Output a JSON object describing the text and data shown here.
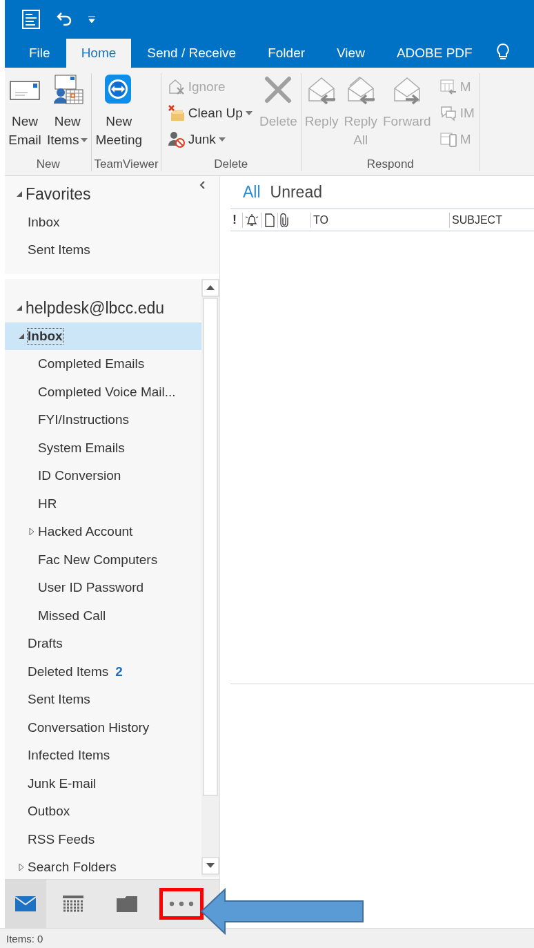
{
  "tabs": [
    {
      "label": "File",
      "selected": false
    },
    {
      "label": "Home",
      "selected": true
    },
    {
      "label": "Send / Receive",
      "selected": false
    },
    {
      "label": "Folder",
      "selected": false
    },
    {
      "label": "View",
      "selected": false
    },
    {
      "label": "ADOBE PDF",
      "selected": false
    }
  ],
  "ribbon": {
    "groups": [
      {
        "label": "New",
        "buttons": [
          {
            "kind": "large",
            "lines": [
              "New",
              "Email"
            ],
            "disabled": false,
            "has_menu": false
          },
          {
            "kind": "large",
            "lines": [
              "New",
              "Items"
            ],
            "disabled": false,
            "has_menu": true
          }
        ]
      },
      {
        "label": "TeamViewer",
        "buttons": [
          {
            "kind": "large",
            "lines": [
              "New",
              "Meeting"
            ],
            "disabled": false,
            "has_menu": false
          }
        ]
      },
      {
        "label": "Delete",
        "buttons": [
          {
            "kind": "stack",
            "items": [
              {
                "label": "Ignore",
                "disabled": true,
                "has_menu": false
              },
              {
                "label": "Clean Up",
                "disabled": false,
                "has_menu": true
              },
              {
                "label": "Junk",
                "disabled": false,
                "has_menu": true
              }
            ]
          },
          {
            "kind": "large",
            "lines": [
              "Delete"
            ],
            "disabled": true,
            "has_menu": false
          }
        ]
      },
      {
        "label": "Respond",
        "buttons": [
          {
            "kind": "large",
            "lines": [
              "Reply"
            ],
            "disabled": true,
            "has_menu": false
          },
          {
            "kind": "large",
            "lines": [
              "Reply",
              "All"
            ],
            "disabled": true,
            "has_menu": false
          },
          {
            "kind": "large",
            "lines": [
              "Forward"
            ],
            "disabled": true,
            "has_menu": false
          },
          {
            "kind": "stack",
            "items": [
              {
                "label": "M",
                "disabled": true,
                "has_menu": false
              },
              {
                "label": "IM",
                "disabled": true,
                "has_menu": false
              },
              {
                "label": "M",
                "disabled": true,
                "has_menu": false
              }
            ]
          }
        ]
      }
    ]
  },
  "folder_pane": {
    "sections": [
      {
        "label": "Favorites",
        "expanded": true,
        "children": [
          {
            "label": "Inbox",
            "selected": false
          },
          {
            "label": "Sent Items",
            "selected": false
          }
        ]
      },
      {
        "label": "helpdesk@lbcc.edu",
        "expanded": true,
        "children": [
          {
            "label": "Inbox",
            "selected": true,
            "expanded": true,
            "children": [
              {
                "label": "Completed Emails",
                "selected": false
              },
              {
                "label": "Completed Voice Mail...",
                "selected": false
              },
              {
                "label": "FYI/Instructions",
                "selected": false
              },
              {
                "label": "System Emails",
                "selected": false
              },
              {
                "label": "ID Conversion",
                "selected": false
              },
              {
                "label": "HR",
                "selected": false
              },
              {
                "label": "Hacked Account",
                "selected": false,
                "expanded": false
              },
              {
                "label": "Fac New Computers",
                "selected": false
              },
              {
                "label": "User ID  Password",
                "selected": false
              },
              {
                "label": "Missed Call",
                "selected": false
              }
            ]
          },
          {
            "label": "Drafts",
            "selected": false
          },
          {
            "label": "Deleted Items",
            "selected": false,
            "count": "2"
          },
          {
            "label": "Sent Items",
            "selected": false
          },
          {
            "label": "Conversation History",
            "selected": false
          },
          {
            "label": "Infected Items",
            "selected": false
          },
          {
            "label": "Junk E-mail",
            "selected": false
          },
          {
            "label": "Outbox",
            "selected": false
          },
          {
            "label": "RSS Feeds",
            "selected": false
          },
          {
            "label": "Search Folders",
            "selected": false,
            "expanded": false
          }
        ]
      }
    ]
  },
  "nav_bar": [
    {
      "kind": "mail",
      "selected": true,
      "highlighted": false
    },
    {
      "kind": "calendar",
      "selected": false,
      "highlighted": false
    },
    {
      "kind": "folders",
      "selected": false,
      "highlighted": false
    },
    {
      "kind": "more",
      "selected": false,
      "highlighted": true
    }
  ],
  "message_list": {
    "filters": [
      {
        "label": "All",
        "selected": true
      },
      {
        "label": "Unread",
        "selected": false
      }
    ],
    "columns": [
      {
        "kind": "importance",
        "label": "!"
      },
      {
        "kind": "reminder"
      },
      {
        "kind": "type"
      },
      {
        "kind": "attachment"
      },
      {
        "kind": "text",
        "label": "TO"
      },
      {
        "kind": "text",
        "label": "SUBJECT"
      }
    ]
  },
  "status_bar": {
    "text": "Items: 0"
  }
}
